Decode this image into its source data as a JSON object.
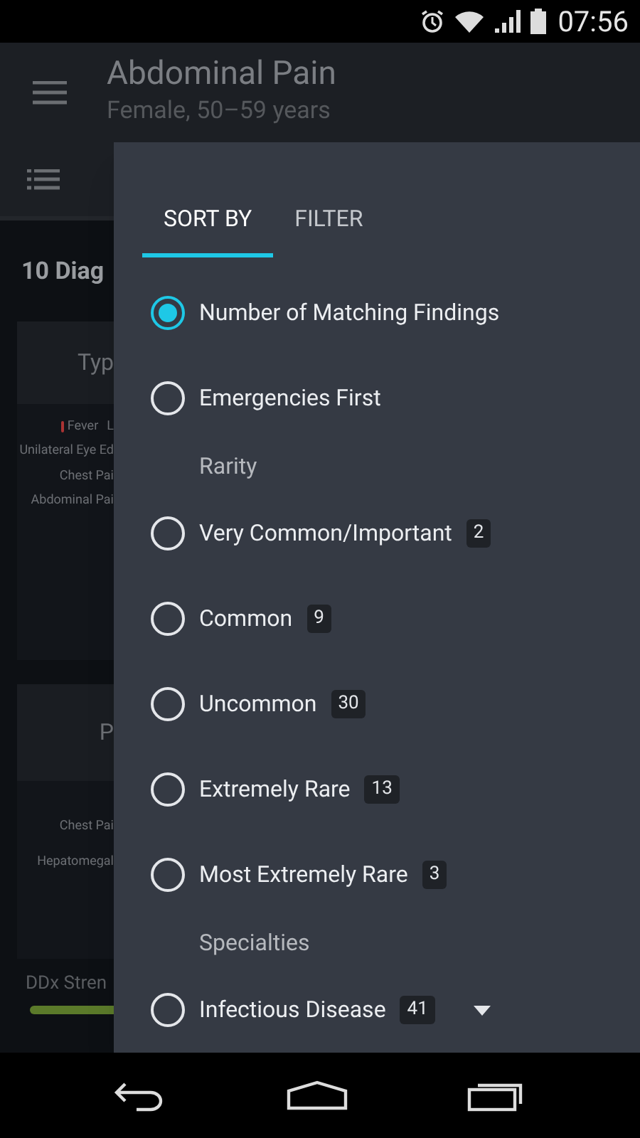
{
  "status_bar": {
    "time": "07:56"
  },
  "app_bar": {
    "title": "Abdominal Pain",
    "subtitle": "Female, 50–59 years"
  },
  "background": {
    "heading": "10 Diag",
    "cards": [
      {
        "title": "Typ",
        "rows": [
          {
            "kind": "fever",
            "texts": [
              "Fever",
              "L"
            ]
          },
          {
            "texts": [
              "Unilateral Eye Ed"
            ]
          },
          {
            "texts": [
              "Chest Pai"
            ]
          },
          {
            "texts": [
              "Abdominal Pai"
            ]
          }
        ]
      },
      {
        "title": "P",
        "rows": [
          {
            "texts": [
              "Chest Pai"
            ]
          },
          {
            "texts": [
              "Hepatomegal"
            ]
          }
        ]
      }
    ],
    "strength_label": "DDx Stren"
  },
  "panel": {
    "tabs": [
      {
        "label": "SORT BY",
        "selected": true
      },
      {
        "label": "FILTER",
        "selected": false
      }
    ],
    "options": [
      {
        "kind": "radio",
        "label": "Number of Matching Findings",
        "selected": true
      },
      {
        "kind": "radio",
        "label": "Emergencies First",
        "selected": false
      },
      {
        "kind": "header",
        "label": "Rarity"
      },
      {
        "kind": "radio",
        "label": "Very Common/Important",
        "count": "2",
        "selected": false
      },
      {
        "kind": "radio",
        "label": "Common",
        "count": "9",
        "selected": false
      },
      {
        "kind": "radio",
        "label": "Uncommon",
        "count": "30",
        "selected": false
      },
      {
        "kind": "radio",
        "label": "Extremely Rare",
        "count": "13",
        "selected": false
      },
      {
        "kind": "radio",
        "label": "Most Extremely Rare",
        "count": "3",
        "selected": false
      },
      {
        "kind": "header",
        "label": "Specialties"
      },
      {
        "kind": "radio",
        "label": "Infectious Disease",
        "count": "41",
        "selected": false,
        "expandable": true
      }
    ]
  }
}
